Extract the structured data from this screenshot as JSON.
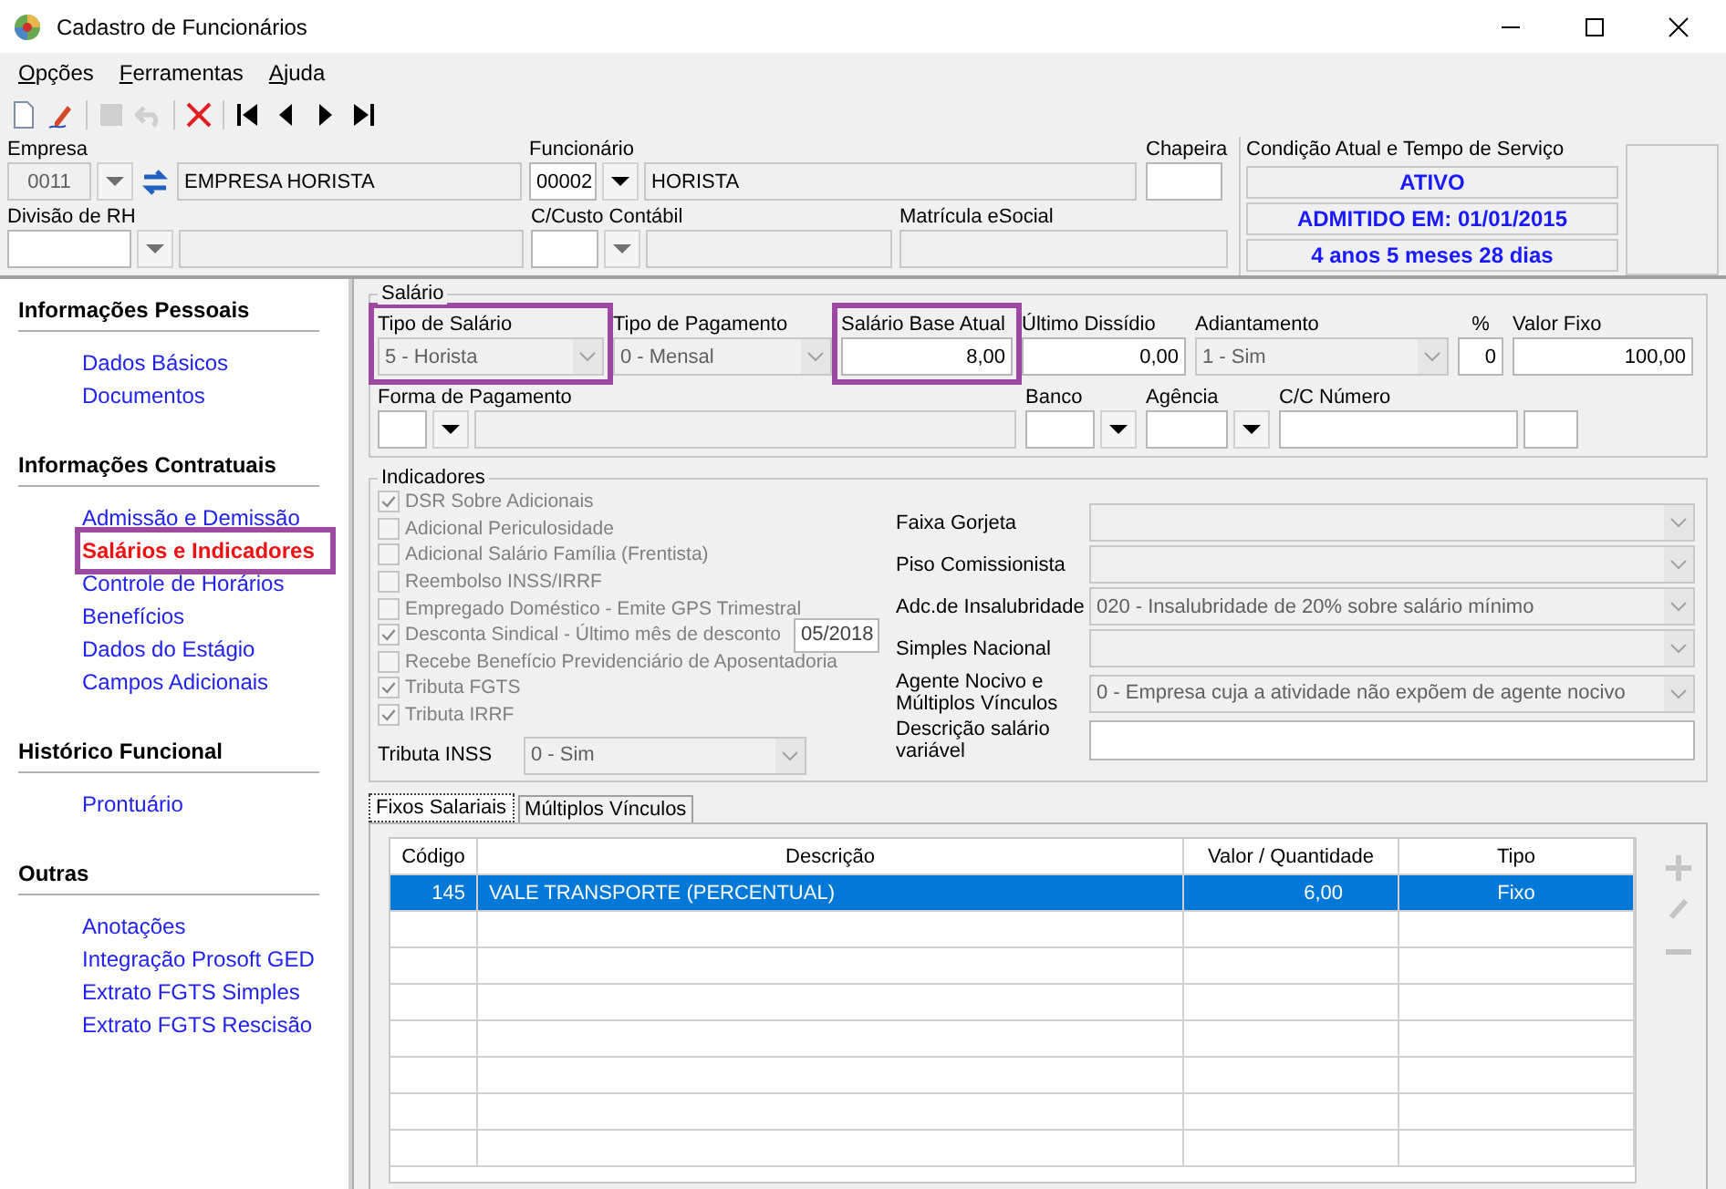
{
  "window": {
    "title": "Cadastro de Funcionários"
  },
  "menu": [
    "Opções",
    "Ferramentas",
    "Ajuda"
  ],
  "toolbar": [
    {
      "kind": "new",
      "disabled": false
    },
    {
      "kind": "edit",
      "disabled": false
    },
    {
      "kind": "save",
      "disabled": true
    },
    {
      "kind": "undo",
      "disabled": true
    },
    {
      "kind": "delete",
      "disabled": false
    },
    {
      "kind": "first",
      "disabled": false
    },
    {
      "kind": "prev",
      "disabled": false
    },
    {
      "kind": "next",
      "disabled": false
    },
    {
      "kind": "last",
      "disabled": false
    }
  ],
  "header": {
    "empresa": {
      "label": "Empresa",
      "code": "0011",
      "name": "EMPRESA HORISTA"
    },
    "funcionario": {
      "label": "Funcionário",
      "code": "00002",
      "name": "HORISTA"
    },
    "chapeira": {
      "label": "Chapeira"
    },
    "divisao": {
      "label": "Divisão de RH"
    },
    "ccusto": {
      "label": "C/Custo Contábil"
    },
    "matricula": {
      "label": "Matrícula eSocial"
    },
    "condicao": {
      "label": "Condição Atual e Tempo de Serviço",
      "lines": [
        "ATIVO",
        "ADMITIDO EM: 01/01/2015",
        "4 anos 5 meses 28 dias"
      ]
    }
  },
  "sidebar": [
    {
      "title": "Informações Pessoais",
      "items": [
        {
          "label": "Dados Básicos",
          "selected": false
        },
        {
          "label": "Documentos",
          "selected": false
        }
      ]
    },
    {
      "title": "Informações Contratuais",
      "items": [
        {
          "label": "Admissão e Demissão",
          "selected": false
        },
        {
          "label": "Salários e Indicadores",
          "selected": true
        },
        {
          "label": "Controle de Horários",
          "selected": false
        },
        {
          "label": "Benefícios",
          "selected": false
        },
        {
          "label": "Dados do Estágio",
          "selected": false
        },
        {
          "label": "Campos Adicionais",
          "selected": false
        }
      ]
    },
    {
      "title": "Histórico Funcional",
      "items": [
        {
          "label": "Prontuário",
          "selected": false
        }
      ]
    },
    {
      "title": "Outras",
      "items": [
        {
          "label": "Anotações",
          "selected": false
        },
        {
          "label": "Integração Prosoft GED",
          "selected": false
        },
        {
          "label": "Extrato FGTS Simples",
          "selected": false
        },
        {
          "label": "Extrato FGTS Rescisão",
          "selected": false
        }
      ]
    }
  ],
  "salario": {
    "title": "Salário",
    "row1": [
      {
        "kind": "combo",
        "label": "Tipo de Salário",
        "value": "5 - Horista",
        "highlighted": true
      },
      {
        "kind": "combo",
        "label": "Tipo de Pagamento",
        "value": "0 - Mensal",
        "highlighted": false
      },
      {
        "kind": "input",
        "label": "Salário Base Atual",
        "value": "8,00",
        "highlighted": true
      },
      {
        "kind": "input",
        "label": "Último Dissídio",
        "value": "0,00",
        "highlighted": false
      },
      {
        "kind": "combo",
        "label": "Adiantamento",
        "value": "1 - Sim",
        "highlighted": false
      },
      {
        "kind": "input",
        "label": "%",
        "value": "0",
        "highlighted": false
      },
      {
        "kind": "input",
        "label": "Valor Fixo",
        "value": "100,00",
        "highlighted": false
      }
    ],
    "forma_pagamento": {
      "label": "Forma de Pagamento"
    },
    "banco": {
      "label": "Banco"
    },
    "agencia": {
      "label": "Agência"
    },
    "conta": {
      "label": "C/C Número"
    }
  },
  "indicadores": {
    "title": "Indicadores",
    "checks": [
      {
        "label": "DSR Sobre Adicionais",
        "checked": true
      },
      {
        "label": "Adicional Periculosidade",
        "checked": false
      },
      {
        "label": "Adicional Salário Família (Frentista)",
        "checked": false
      },
      {
        "label": "Reembolso INSS/IRRF",
        "checked": false
      },
      {
        "label": "Empregado Doméstico - Emite GPS Trimestral",
        "checked": false
      },
      {
        "label": "Desconta Sindical - Último mês de desconto",
        "checked": true,
        "value": "05/2018"
      },
      {
        "label": "Recebe Benefício Previdenciário de Aposentadoria",
        "checked": false
      },
      {
        "label": "Tributa FGTS",
        "checked": true
      },
      {
        "label": "Tributa IRRF",
        "checked": true
      }
    ],
    "tributa_inss": {
      "label": "Tributa INSS",
      "value": "0 - Sim"
    },
    "fields": [
      {
        "kind": "combo",
        "label": "Faixa Gorjeta"
      },
      {
        "kind": "combo",
        "label": "Piso Comissionista"
      },
      {
        "kind": "combo",
        "label": "Adc.de Insalubridade",
        "value": "020 - Insalubridade de 20% sobre salário mínimo"
      },
      {
        "kind": "combo",
        "label": "Simples Nacional"
      },
      {
        "kind": "combo",
        "label": "Agente Nocivo e Múltiplos Vínculos",
        "value": "0 - Empresa cuja a atividade não expõem de agente nocivo"
      },
      {
        "kind": "input",
        "label": "Descrição salário variável"
      }
    ]
  },
  "tabs": [
    {
      "label": "Fixos Salariais",
      "selected": true
    },
    {
      "label": "Múltiplos Vínculos",
      "selected": false
    }
  ],
  "table": {
    "columns": [
      "Código",
      "Descrição",
      "Valor / Quantidade",
      "Tipo"
    ],
    "rows": [
      {
        "cells": [
          "145",
          "VALE TRANSPORTE (PERCENTUAL)",
          "6,00",
          "Fixo"
        ],
        "selected": true
      }
    ]
  },
  "side_buttons": [
    {
      "kind": "add",
      "disabled": true
    },
    {
      "kind": "edit",
      "disabled": true
    },
    {
      "kind": "remove",
      "disabled": true
    }
  ]
}
